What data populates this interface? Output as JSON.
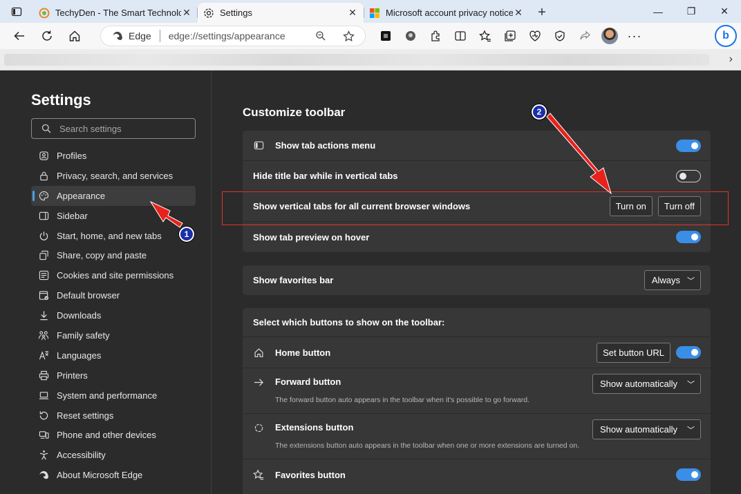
{
  "browser": {
    "tabs": [
      {
        "title": "TechyDen - The Smart Technolog",
        "active": false
      },
      {
        "title": "Settings",
        "active": true
      },
      {
        "title": "Microsoft account privacy notice",
        "active": false
      }
    ],
    "address": {
      "site_label": "Edge",
      "url": "edge://settings/appearance"
    }
  },
  "sidebar": {
    "title": "Settings",
    "search_placeholder": "Search settings",
    "items": [
      {
        "label": "Profiles",
        "icon": "profile-icon"
      },
      {
        "label": "Privacy, search, and services",
        "icon": "lock-icon"
      },
      {
        "label": "Appearance",
        "icon": "palette-icon",
        "active": true
      },
      {
        "label": "Sidebar",
        "icon": "sidebar-icon"
      },
      {
        "label": "Start, home, and new tabs",
        "icon": "power-icon"
      },
      {
        "label": "Share, copy and paste",
        "icon": "share-icon"
      },
      {
        "label": "Cookies and site permissions",
        "icon": "cookie-icon"
      },
      {
        "label": "Default browser",
        "icon": "browser-icon"
      },
      {
        "label": "Downloads",
        "icon": "download-icon"
      },
      {
        "label": "Family safety",
        "icon": "family-icon"
      },
      {
        "label": "Languages",
        "icon": "language-icon"
      },
      {
        "label": "Printers",
        "icon": "printer-icon"
      },
      {
        "label": "System and performance",
        "icon": "laptop-icon"
      },
      {
        "label": "Reset settings",
        "icon": "reset-icon"
      },
      {
        "label": "Phone and other devices",
        "icon": "phone-icon"
      },
      {
        "label": "Accessibility",
        "icon": "accessibility-icon"
      },
      {
        "label": "About Microsoft Edge",
        "icon": "edge-icon"
      }
    ]
  },
  "main": {
    "section_title": "Customize toolbar",
    "tab_rows": [
      {
        "label": "Show tab actions menu",
        "toggle": "on"
      },
      {
        "label": "Hide title bar while in vertical tabs",
        "toggle": "off"
      },
      {
        "label": "Show vertical tabs for all current browser windows",
        "buttons": [
          "Turn on",
          "Turn off"
        ]
      },
      {
        "label": "Show tab preview on hover",
        "toggle": "on"
      }
    ],
    "favorites_bar": {
      "label": "Show favorites bar",
      "value": "Always"
    },
    "buttons_section": {
      "header": "Select which buttons to show on the toolbar:",
      "home": {
        "label": "Home button",
        "button": "Set button URL",
        "toggle": "on"
      },
      "forward": {
        "label": "Forward button",
        "value": "Show automatically",
        "desc": "The forward button auto appears in the toolbar when it's possible to go forward."
      },
      "extensions": {
        "label": "Extensions button",
        "value": "Show automatically",
        "desc": "The extensions button auto appears in the toolbar when one or more extensions are turned on."
      },
      "favorites": {
        "label": "Favorites button",
        "toggle": "on"
      }
    }
  },
  "annotations": {
    "badge1": "1",
    "badge2": "2",
    "color": "#e5332a"
  }
}
